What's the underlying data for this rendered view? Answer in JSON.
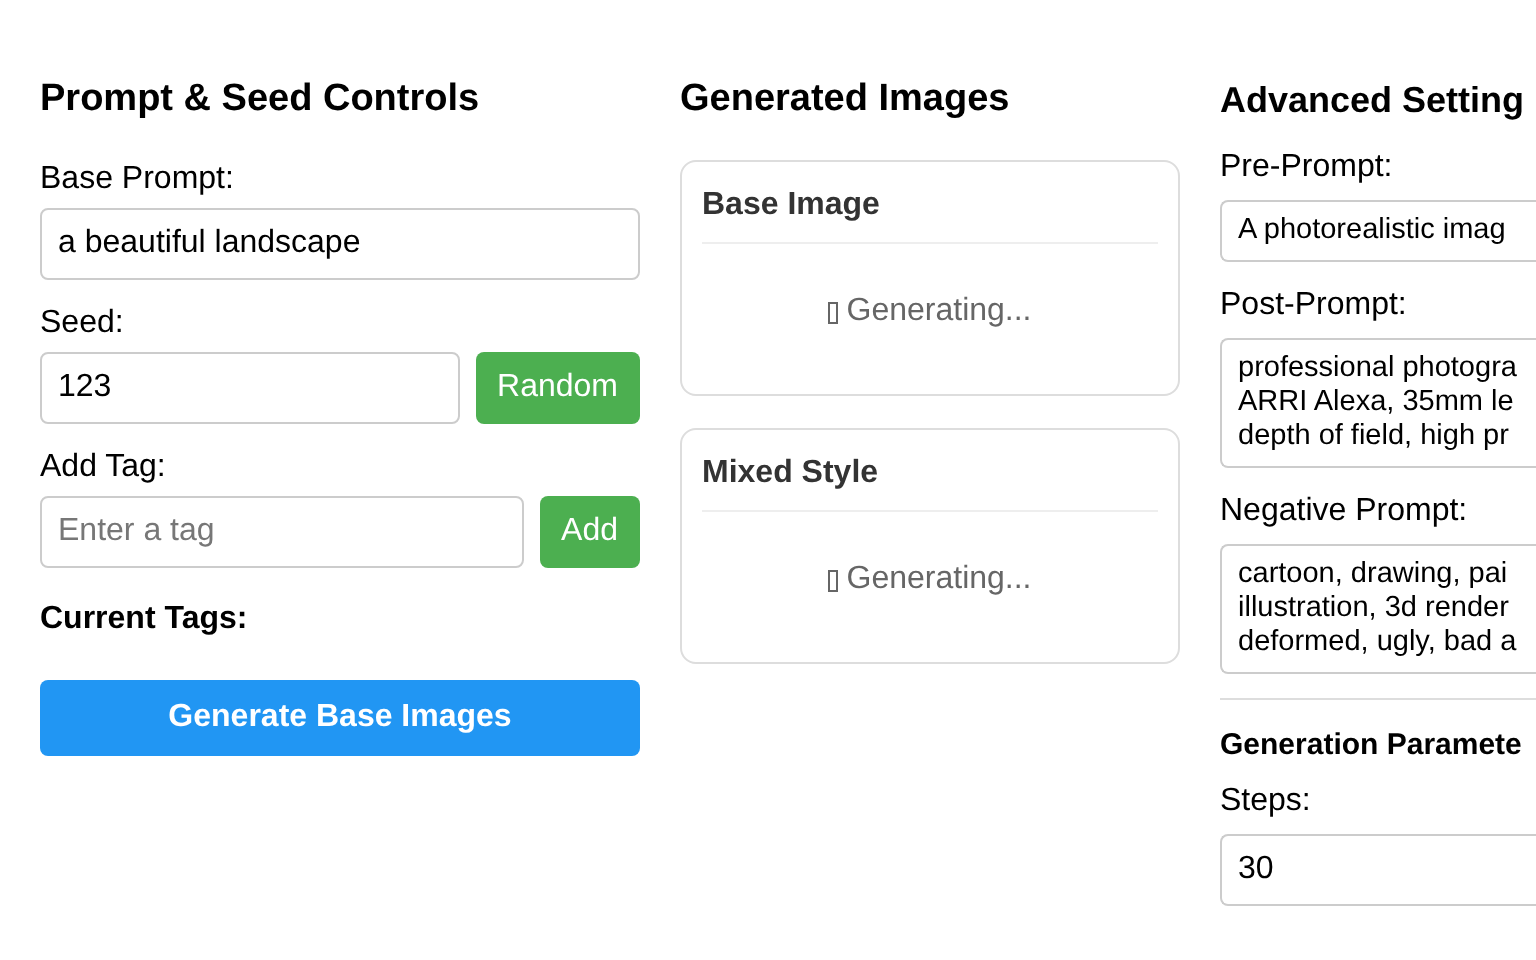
{
  "prompt_controls": {
    "title": "Prompt & Seed Controls",
    "base_prompt": {
      "label": "Base Prompt:",
      "value": "a beautiful landscape"
    },
    "seed": {
      "label": "Seed:",
      "value": "123",
      "button": "Random"
    },
    "add_tag": {
      "label": "Add Tag:",
      "placeholder": "Enter a tag",
      "button": "Add"
    },
    "current_tags_label": "Current Tags:",
    "generate_button": "Generate Base Images"
  },
  "generated_images": {
    "title": "Generated Images",
    "cards": [
      {
        "title": "Base Image",
        "status": "Generating..."
      },
      {
        "title": "Mixed Style",
        "status": "Generating..."
      }
    ]
  },
  "advanced_settings": {
    "title": "Advanced Setting",
    "fields": [
      {
        "label": "Pre-Prompt:",
        "lines": [
          "A photorealistic imag"
        ]
      },
      {
        "label": "Post-Prompt:",
        "lines": [
          "professional photogra",
          "ARRI Alexa, 35mm le",
          "depth of field, high pr"
        ]
      },
      {
        "label": "Negative Prompt:",
        "lines": [
          "cartoon, drawing, pai",
          "illustration, 3d render",
          "deformed, ugly, bad a"
        ]
      }
    ],
    "parameters": {
      "title": "Generation Paramete",
      "steps": {
        "label": "Steps:",
        "value": "30"
      }
    }
  }
}
